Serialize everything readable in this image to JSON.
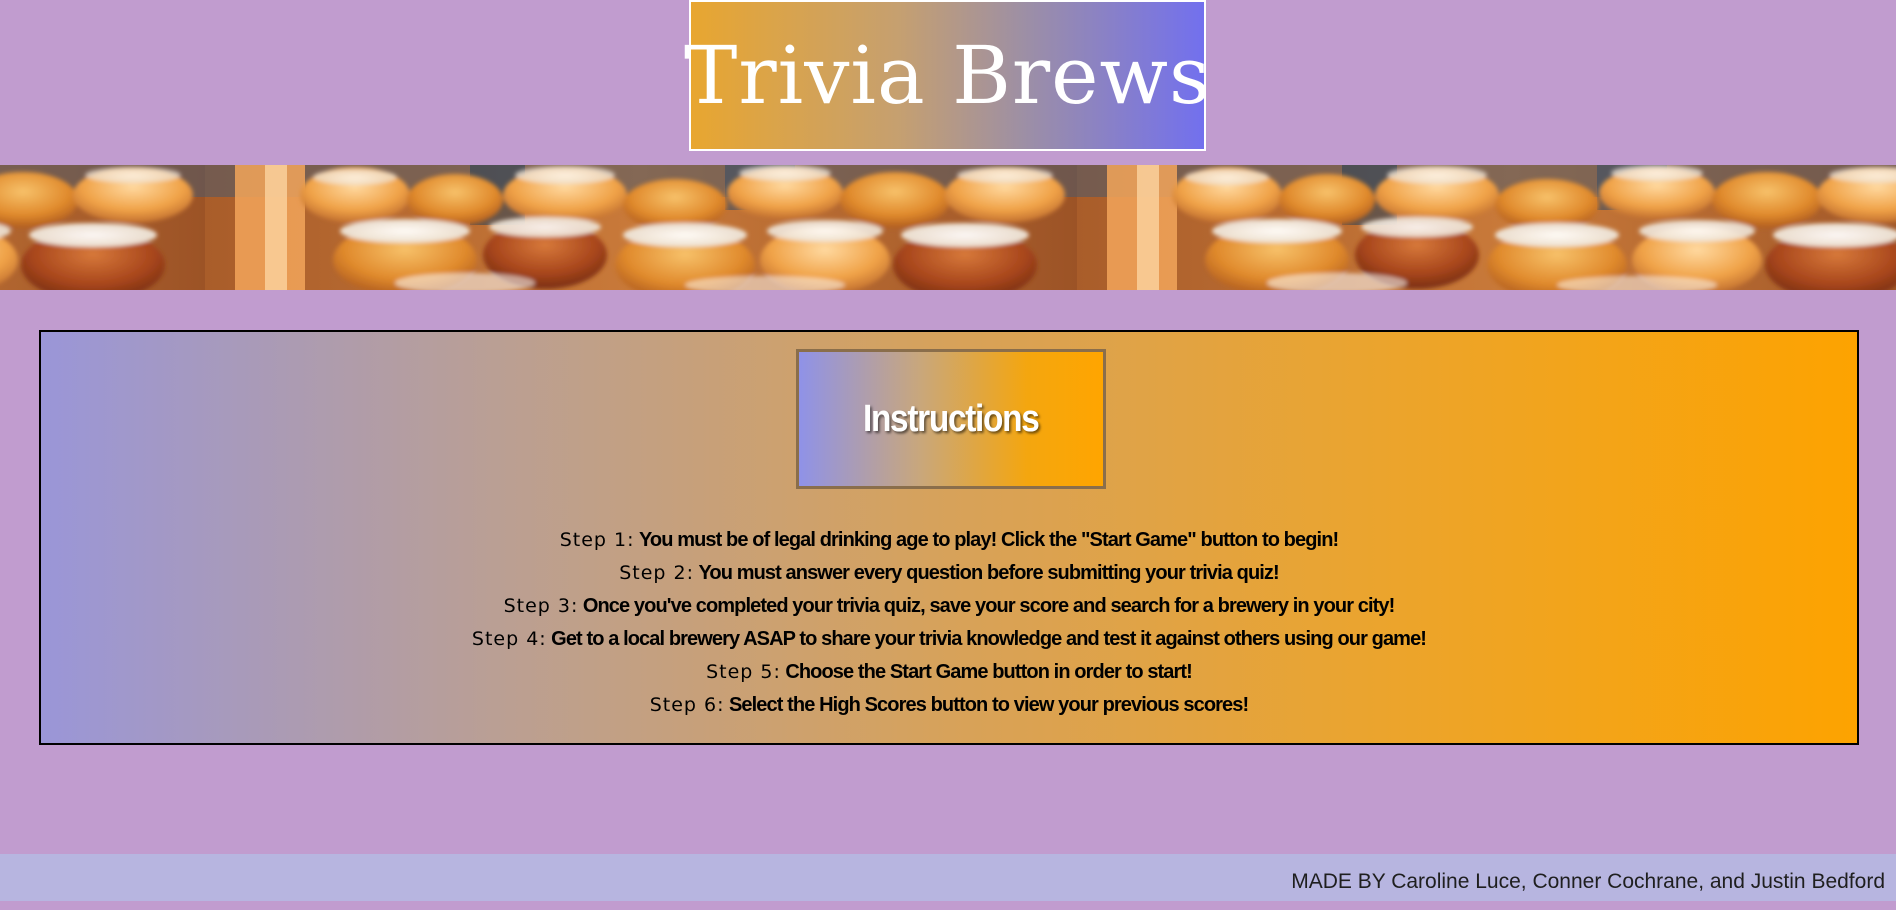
{
  "header": {
    "title": "Trivia Brews"
  },
  "banner": {
    "image": "beer-flight-photo"
  },
  "instructions": {
    "heading": "Instructions",
    "steps": [
      {
        "label": "Step 1:",
        "text": "You must be of legal drinking age to play! Click the \"Start Game\" button to begin!"
      },
      {
        "label": "Step 2:",
        "text": "You must answer every question before submitting your trivia quiz!"
      },
      {
        "label": "Step 3:",
        "text": "Once you've completed your trivia quiz, save your score and search for a brewery in your city!"
      },
      {
        "label": "Step 4:",
        "text": "Get to a local brewery ASAP to share your trivia knowledge and test it against others using our game!"
      },
      {
        "label": "Step 5:",
        "text": "Choose the Start Game button in order to start!"
      },
      {
        "label": "Step 6:",
        "text": "Select the High Scores button to view your previous scores!"
      }
    ]
  },
  "footer": {
    "credits": "MADE BY Caroline Luce, Conner Cochrane, and Justin Bedford"
  },
  "colors": {
    "page_background": "#c19ccf",
    "footer_background": "#b7b5e0",
    "panel_border": "#000000",
    "accent_orange": "#ffa500",
    "accent_purple": "#7270ee"
  }
}
